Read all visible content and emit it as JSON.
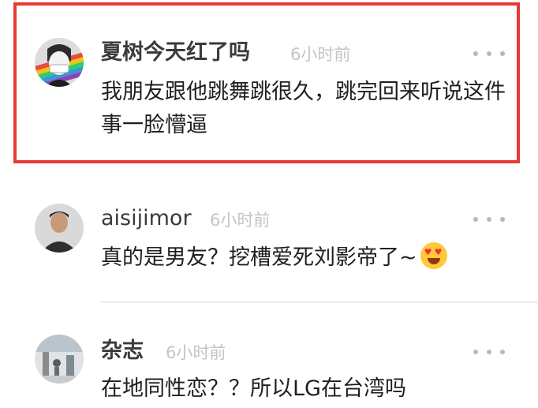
{
  "comments": [
    {
      "username": "夏树今天红了吗",
      "time": "6小时前",
      "content": "我朋友跟他跳舞跳很久，跳完回来听说这件事一脸懵逼",
      "avatar_icon": "rainbow-masked-person-avatar"
    },
    {
      "username": "aisijimor",
      "time": "6小时前",
      "content": "真的是男友？挖槽爱死刘影帝了~",
      "emoji": "heart-eyes-emoji",
      "avatar_icon": "man-portrait-avatar"
    },
    {
      "username": "杂志",
      "time": "6小时前",
      "content": "在地同性恋？？所以LG在台湾吗",
      "avatar_icon": "street-scene-avatar"
    }
  ],
  "colors": {
    "highlight": "#e53935",
    "username": "#3b3b3b",
    "time": "#c4c4c4",
    "content": "#1f1f1f"
  }
}
